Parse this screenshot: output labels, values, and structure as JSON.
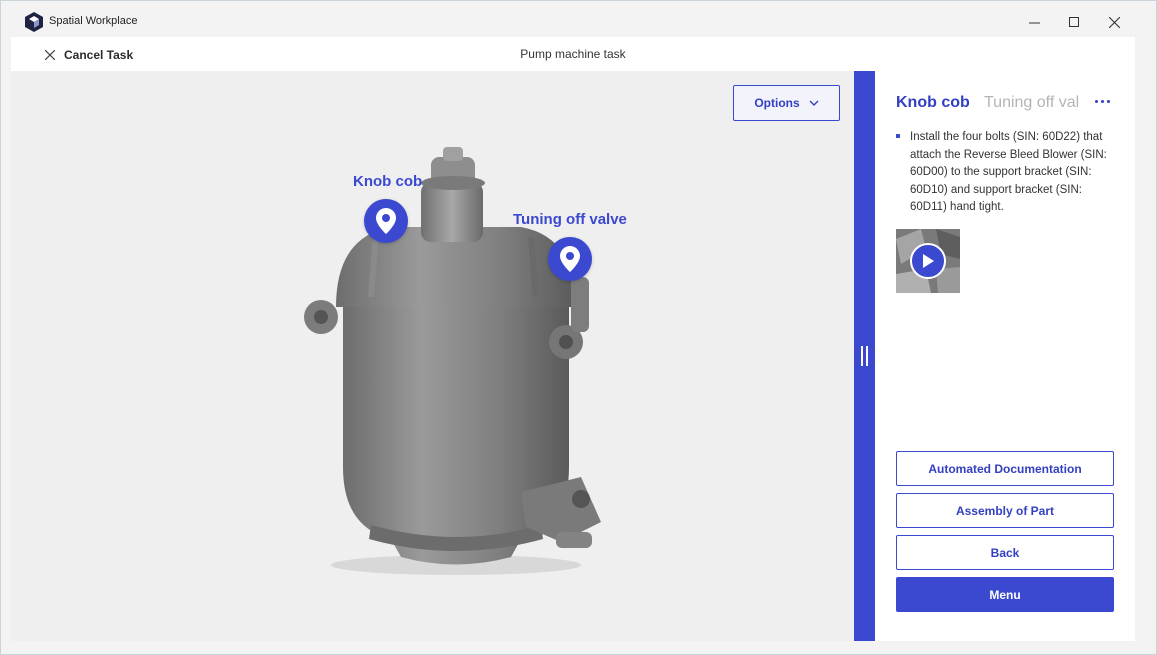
{
  "window": {
    "app_title": "Spatial Workplace",
    "logo_icon": "cube-logo-icon",
    "controls": [
      "minimize-icon",
      "maximize-icon",
      "close-icon"
    ]
  },
  "topbar": {
    "cancel_label": "Cancel Task",
    "task_title": "Pump machine task"
  },
  "viewport": {
    "options_label": "Options",
    "hotspots": [
      {
        "label": "Knob cob"
      },
      {
        "label": "Tuning off valve"
      }
    ]
  },
  "panel": {
    "tabs": [
      {
        "label": "Knob cob",
        "active": true
      },
      {
        "label": "Tuning off val",
        "active": false
      }
    ],
    "instructions": [
      "Install the four bolts (SIN: 60D22) that attach the Reverse Bleed Blower (SIN: 60D00) to the support bracket (SIN: 60D10) and support bracket (SIN: 60D11) hand tight."
    ],
    "buttons": {
      "automated_documentation": "Automated Documentation",
      "assembly_of_part": "Assembly of Part",
      "back": "Back",
      "menu": "Menu"
    }
  },
  "colors": {
    "accent": "#3b48d0",
    "background": "#efefef",
    "panel": "#ffffff"
  }
}
